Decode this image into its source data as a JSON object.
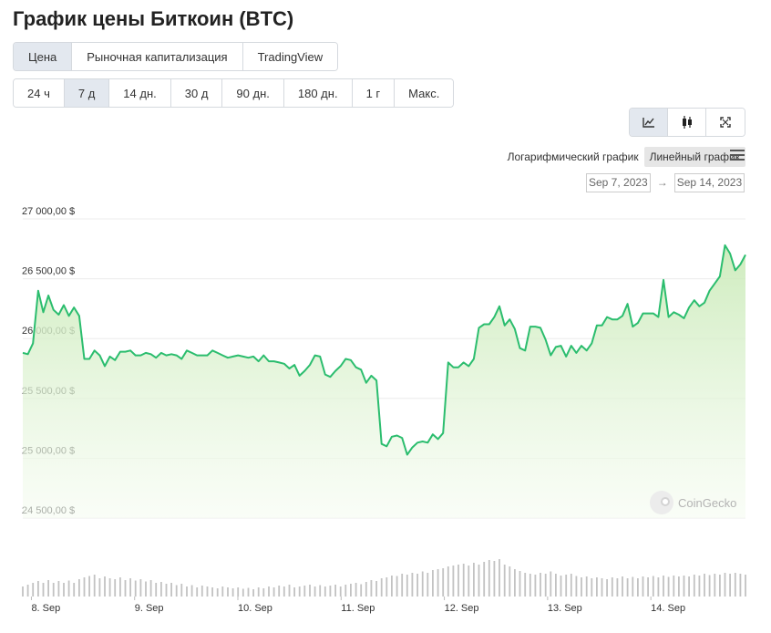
{
  "page": {
    "title": "График цены Биткоин (BTC)"
  },
  "tabs": [
    {
      "label": "Цена",
      "active": true
    },
    {
      "label": "Рыночная капитализация",
      "active": false
    },
    {
      "label": "TradingView",
      "active": false
    }
  ],
  "ranges": [
    {
      "label": "24 ч",
      "active": false
    },
    {
      "label": "7 д",
      "active": true
    },
    {
      "label": "14 дн.",
      "active": false
    },
    {
      "label": "30 д",
      "active": false
    },
    {
      "label": "90 дн.",
      "active": false
    },
    {
      "label": "180 дн.",
      "active": false
    },
    {
      "label": "1 г",
      "active": false
    },
    {
      "label": "Макс.",
      "active": false
    }
  ],
  "chart_types": [
    {
      "icon": "line-chart-icon",
      "active": true
    },
    {
      "icon": "candlestick-icon",
      "active": false
    },
    {
      "icon": "fullscreen-icon",
      "active": false
    }
  ],
  "scale": {
    "log_label": "Логарифмический график",
    "linear_label": "Линейный график",
    "active": "linear"
  },
  "date_range": {
    "from": "Sep 7, 2023",
    "to": "Sep 14, 2023",
    "arrow": "→"
  },
  "watermark": {
    "text": "CoinGecko"
  },
  "colors": {
    "line": "#2bbd6e",
    "area_top": "#c9eab7",
    "area_bottom": "#f6fcf2",
    "volume": "#c2c2c2",
    "active_bg": "#e3e8ef"
  },
  "chart_data": {
    "type": "area",
    "ylim": [
      24500,
      27000
    ],
    "yticks": [
      24500,
      25000,
      25500,
      26000,
      26500,
      27000
    ],
    "ytick_labels": [
      "24 500,00 $",
      "25 000,00 $",
      "25 500,00 $",
      "26 000,00 $",
      "26 500,00 $",
      "27 000,00 $"
    ],
    "x_start": "2023-09-07T22:00",
    "x_end": "2023-09-14T22:00",
    "xtick_labels": [
      "8. Sep",
      "9. Sep",
      "10. Sep",
      "11. Sep",
      "12. Sep",
      "13. Sep",
      "14. Sep"
    ],
    "price": [
      25880,
      25870,
      25960,
      26400,
      26220,
      26360,
      26240,
      26200,
      26280,
      26190,
      26260,
      26190,
      25830,
      25830,
      25900,
      25860,
      25770,
      25850,
      25820,
      25890,
      25890,
      25900,
      25860,
      25860,
      25880,
      25870,
      25840,
      25880,
      25860,
      25870,
      25860,
      25830,
      25900,
      25880,
      25860,
      25860,
      25860,
      25900,
      25880,
      25860,
      25840,
      25850,
      25860,
      25850,
      25840,
      25850,
      25810,
      25860,
      25810,
      25810,
      25800,
      25790,
      25750,
      25780,
      25690,
      25730,
      25780,
      25860,
      25850,
      25700,
      25680,
      25730,
      25770,
      25830,
      25820,
      25760,
      25740,
      25630,
      25690,
      25650,
      25120,
      25100,
      25180,
      25190,
      25170,
      25030,
      25090,
      25130,
      25140,
      25130,
      25200,
      25160,
      25210,
      25800,
      25760,
      25760,
      25800,
      25770,
      25830,
      26090,
      26120,
      26120,
      26180,
      26270,
      26110,
      26160,
      26080,
      25920,
      25900,
      26100,
      26100,
      26090,
      25990,
      25860,
      25930,
      25940,
      25850,
      25940,
      25880,
      25940,
      25900,
      25960,
      26110,
      26110,
      26180,
      26160,
      26160,
      26190,
      26290,
      26100,
      26130,
      26210,
      26210,
      26210,
      26180,
      26490,
      26180,
      26220,
      26200,
      26170,
      26260,
      26320,
      26270,
      26300,
      26400,
      26460,
      26520,
      26780,
      26710,
      26570,
      26620,
      26700
    ],
    "volume": [
      0.22,
      0.26,
      0.3,
      0.34,
      0.3,
      0.36,
      0.3,
      0.34,
      0.3,
      0.35,
      0.3,
      0.38,
      0.42,
      0.45,
      0.48,
      0.4,
      0.44,
      0.4,
      0.38,
      0.42,
      0.36,
      0.4,
      0.35,
      0.38,
      0.33,
      0.36,
      0.3,
      0.32,
      0.28,
      0.3,
      0.25,
      0.28,
      0.22,
      0.25,
      0.2,
      0.24,
      0.22,
      0.2,
      0.18,
      0.22,
      0.2,
      0.18,
      0.2,
      0.17,
      0.19,
      0.16,
      0.2,
      0.18,
      0.22,
      0.2,
      0.24,
      0.22,
      0.26,
      0.2,
      0.22,
      0.24,
      0.26,
      0.22,
      0.25,
      0.22,
      0.24,
      0.26,
      0.22,
      0.26,
      0.28,
      0.3,
      0.27,
      0.32,
      0.36,
      0.34,
      0.4,
      0.42,
      0.46,
      0.45,
      0.5,
      0.48,
      0.52,
      0.5,
      0.55,
      0.52,
      0.58,
      0.6,
      0.62,
      0.66,
      0.68,
      0.7,
      0.72,
      0.68,
      0.74,
      0.7,
      0.76,
      0.8,
      0.78,
      0.82,
      0.7,
      0.66,
      0.6,
      0.56,
      0.52,
      0.5,
      0.48,
      0.52,
      0.5,
      0.55,
      0.5,
      0.46,
      0.48,
      0.5,
      0.45,
      0.42,
      0.44,
      0.4,
      0.42,
      0.4,
      0.38,
      0.42,
      0.4,
      0.44,
      0.4,
      0.43,
      0.4,
      0.44,
      0.42,
      0.45,
      0.42,
      0.46,
      0.43,
      0.46,
      0.44,
      0.46,
      0.44,
      0.48,
      0.46,
      0.5,
      0.47,
      0.5,
      0.48,
      0.52,
      0.5,
      0.52,
      0.5,
      0.48
    ]
  }
}
